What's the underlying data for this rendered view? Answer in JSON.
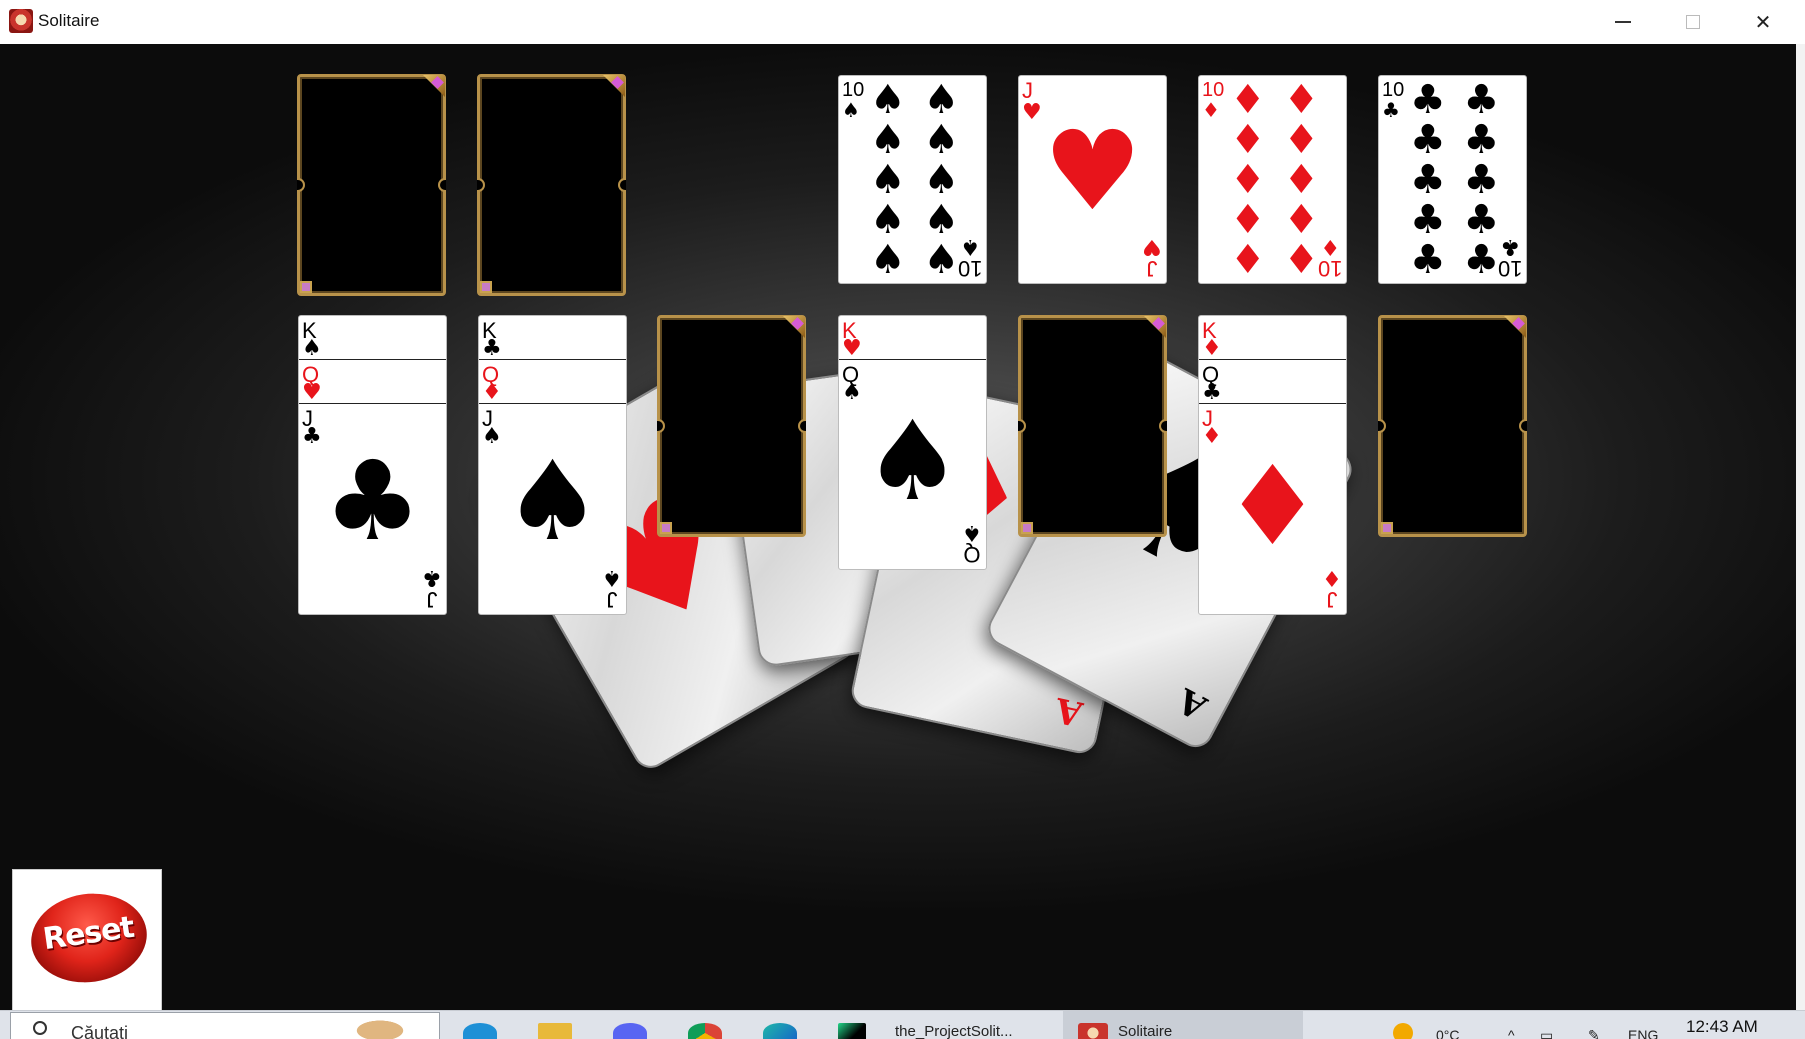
{
  "window": {
    "title": "Solitaire",
    "controls": {
      "minimize": "minimize",
      "maximize": "maximize",
      "close": "close"
    }
  },
  "foundations": [
    {
      "rank": "10",
      "suit": "♠",
      "color": "black"
    },
    {
      "rank": "J",
      "suit": "♥",
      "color": "red"
    },
    {
      "rank": "10",
      "suit": "♦",
      "color": "red"
    },
    {
      "rank": "10",
      "suit": "♣",
      "color": "black"
    }
  ],
  "tableau": {
    "col1": [
      {
        "rank": "K",
        "suit": "♠"
      },
      {
        "rank": "Q",
        "suit": "♥"
      },
      {
        "rank": "J",
        "suit": "♣"
      }
    ],
    "col2": [
      {
        "rank": "K",
        "suit": "♣"
      },
      {
        "rank": "Q",
        "suit": "♦"
      },
      {
        "rank": "J",
        "suit": "♠"
      }
    ],
    "col4": [
      {
        "rank": "K",
        "suit": "♥"
      },
      {
        "rank": "Q",
        "suit": "♠"
      }
    ],
    "col6": [
      {
        "rank": "K",
        "suit": "♦"
      },
      {
        "rank": "Q",
        "suit": "♣"
      },
      {
        "rank": "J",
        "suit": "♦"
      }
    ]
  },
  "background_aces": [
    {
      "rank": "A",
      "suit": "♥"
    },
    {
      "rank": "A",
      "suit": "♣"
    },
    {
      "rank": "A",
      "suit": "♦"
    },
    {
      "rank": "A",
      "suit": "♠"
    }
  ],
  "reset": {
    "label": "Reset"
  },
  "taskbar": {
    "search_placeholder": "Căutați",
    "pycharm_label": "the_ProjectSolit...",
    "solitaire_label": "Solitaire",
    "weather": "0°C",
    "language": "ENG",
    "time": "12:43 AM"
  },
  "colors": {
    "felt_center": "#5a5a5a",
    "felt_edge": "#0c0c0c",
    "slot_border": "#b8924a",
    "red_suit": "#e8141b",
    "reset_red": "#e0241a"
  }
}
